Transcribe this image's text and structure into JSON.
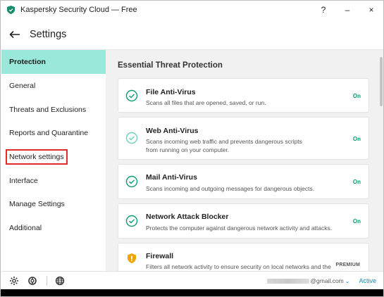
{
  "window": {
    "title": "Kaspersky Security Cloud — Free",
    "controls": {
      "help": "?",
      "minimize": "–",
      "close": "×"
    }
  },
  "header": {
    "title": "Settings"
  },
  "sidebar": {
    "items": [
      {
        "label": "Protection"
      },
      {
        "label": "General"
      },
      {
        "label": "Threats and Exclusions"
      },
      {
        "label": "Reports and Quarantine"
      },
      {
        "label": "Network settings"
      },
      {
        "label": "Interface"
      },
      {
        "label": "Manage Settings"
      },
      {
        "label": "Additional"
      }
    ]
  },
  "content": {
    "section_title": "Essential Threat Protection",
    "cards": [
      {
        "title": "File Anti-Virus",
        "desc": "Scans all files that are opened, saved, or run.",
        "status": "On"
      },
      {
        "title": "Web Anti-Virus",
        "desc": "Scans incoming web traffic and prevents dangerous scripts from running on your computer.",
        "status": "On"
      },
      {
        "title": "Mail Anti-Virus",
        "desc": "Scans incoming and outgoing messages for dangerous objects.",
        "status": "On"
      },
      {
        "title": "Network Attack Blocker",
        "desc": "Protects the computer against dangerous network activity and attacks.",
        "status": "On"
      },
      {
        "title": "Firewall",
        "desc": "Filters all network activity to ensure security on local networks and the Internet.",
        "status": "PREMIUM"
      }
    ]
  },
  "footer": {
    "email_suffix": "@gmail.com",
    "status": "Active"
  },
  "colors": {
    "accent": "#9ae8d9",
    "status_on": "#0e9b73",
    "link": "#0e8fbd",
    "highlight_box": "#e02b2b",
    "shield_brand": "#1a8a6a",
    "firewall_icon": "#f0a500"
  },
  "icons": {
    "app": "kaspersky-shield-icon",
    "back": "arrow-left-icon",
    "check": "check-circle-icon",
    "firewall": "shield-warning-icon",
    "settings": "gear-icon",
    "support": "lifebuoy-icon",
    "language": "globe-icon"
  }
}
